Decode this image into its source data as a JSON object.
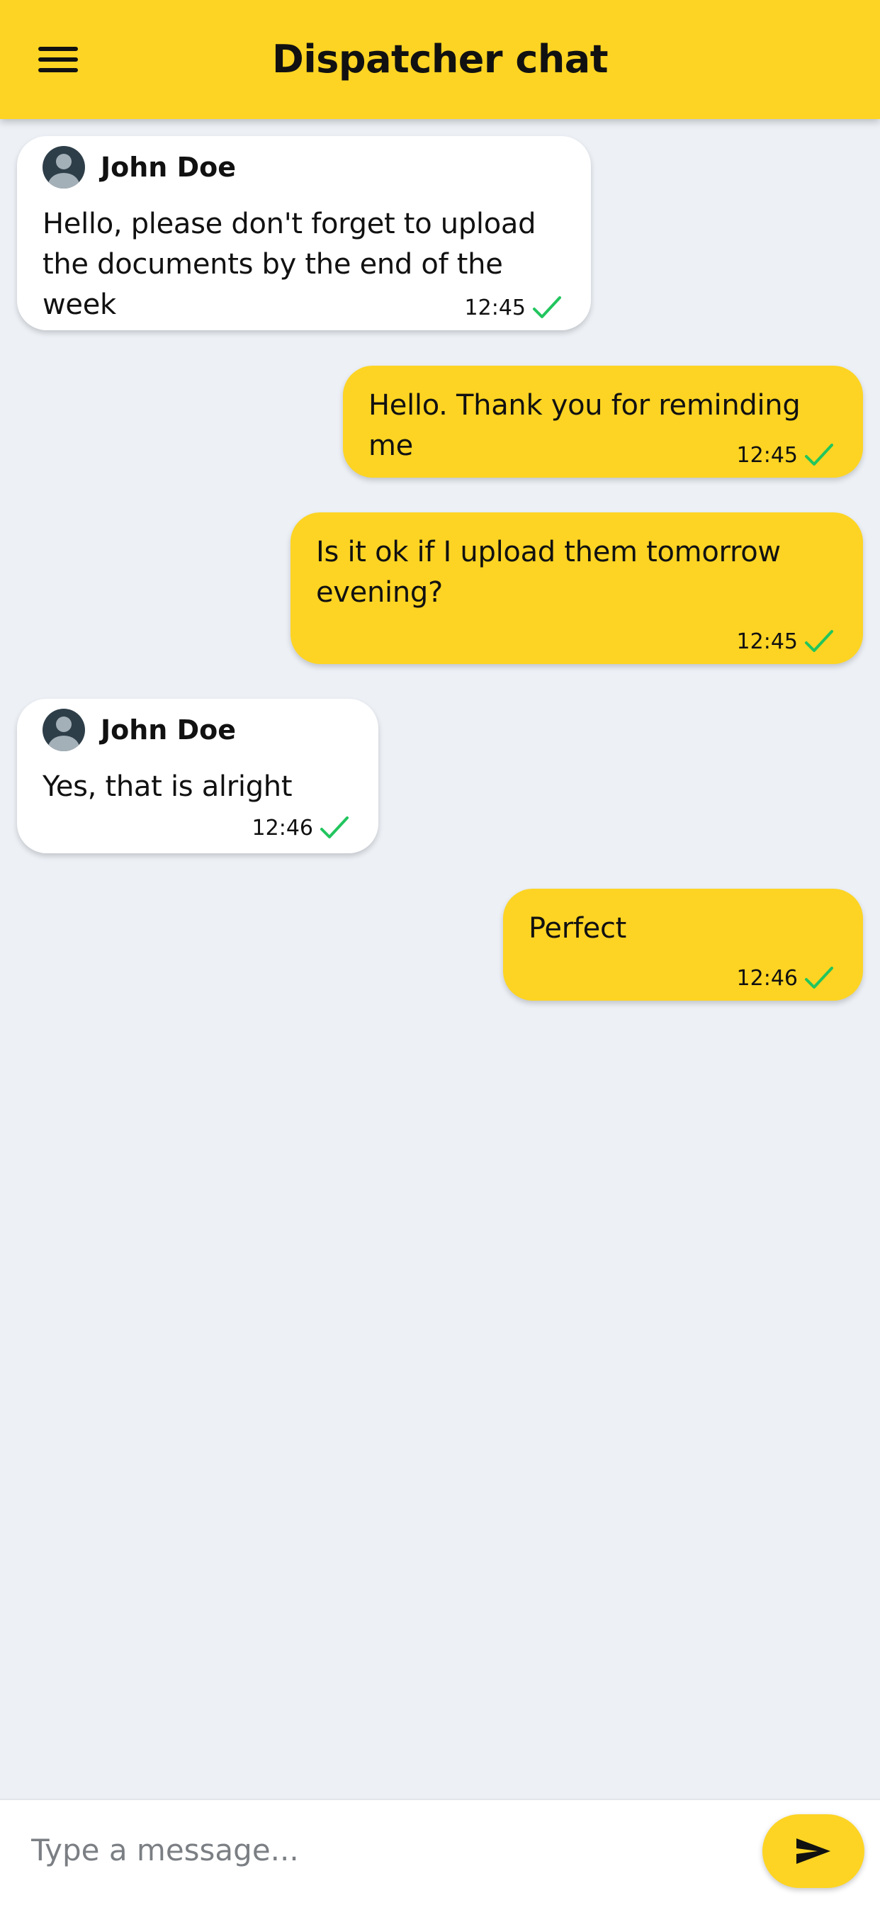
{
  "header": {
    "title": "Dispatcher chat",
    "menu_icon": "hamburger-menu-icon"
  },
  "colors": {
    "accent": "#fdd423",
    "background": "#edf1f6",
    "incoming_bubble": "#ffffff",
    "read_check": "#22c55e"
  },
  "messages": [
    {
      "direction": "incoming",
      "sender": "John Doe",
      "text": "Hello, please don't forget to upload the documents by the end of the week",
      "time": "12:45",
      "status_icon": "check-icon"
    },
    {
      "direction": "outgoing",
      "text": "Hello. Thank you for reminding me",
      "time": "12:45",
      "status_icon": "check-icon"
    },
    {
      "direction": "outgoing",
      "text": "Is it ok if I upload them tomorrow evening?",
      "time": "12:45",
      "status_icon": "check-icon"
    },
    {
      "direction": "incoming",
      "sender": "John Doe",
      "text": "Yes, that is alright",
      "time": "12:46",
      "status_icon": "check-icon"
    },
    {
      "direction": "outgoing",
      "text": "Perfect",
      "time": "12:46",
      "status_icon": "check-icon"
    }
  ],
  "composer": {
    "value": "",
    "placeholder": "Type a message...",
    "send_icon": "send-icon"
  }
}
